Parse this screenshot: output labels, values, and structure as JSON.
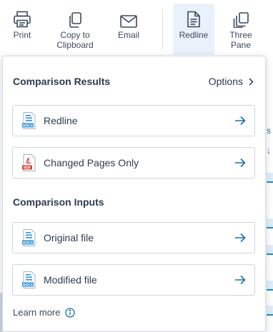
{
  "toolbar": {
    "print": "Print",
    "copy": "Copy to\nClipboard",
    "email": "Email",
    "redline": "Redline",
    "three_pane": "Three\nPane"
  },
  "panel": {
    "results_title": "Comparison Results",
    "options_label": "Options",
    "results": [
      {
        "label": "Redline",
        "file_type": "DOCX"
      },
      {
        "label": "Changed Pages Only",
        "file_type": "PDF"
      }
    ],
    "inputs_title": "Comparison Inputs",
    "inputs": [
      {
        "label": "Original file",
        "file_type": "DOCX"
      },
      {
        "label": "Modified file",
        "file_type": "DOCX"
      }
    ],
    "learn_more": "Learn more"
  },
  "colors": {
    "accent": "#1d6ea8",
    "text": "#2d3b4f",
    "active_bg": "#e9f1fb",
    "pdf_red": "#d9473a",
    "docx_blue": "#2f8fd6"
  }
}
